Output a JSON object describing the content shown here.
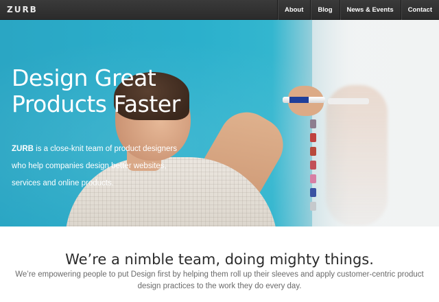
{
  "header": {
    "logo": "ZURB",
    "nav": [
      "About",
      "Blog",
      "News & Events",
      "Contact"
    ]
  },
  "hero": {
    "title_line1": "Design Great",
    "title_line2": "Products Faster",
    "text_brand": "ZURB",
    "text_rest": " is a close-knit team of product designers who help companies design better websites, services and online products."
  },
  "intro": {
    "heading": "We’re a nimble team, doing mighty things.",
    "text": "We’re empowering people to put Design first by helping them roll up their sleeves and apply customer-centric product design practices to the work they do every day."
  },
  "colors": {
    "topbar": "#2e2e2e",
    "hero_bg": "#2bb0cc",
    "heading_text": "#2b2b2b",
    "body_text": "#6a6a6a"
  }
}
